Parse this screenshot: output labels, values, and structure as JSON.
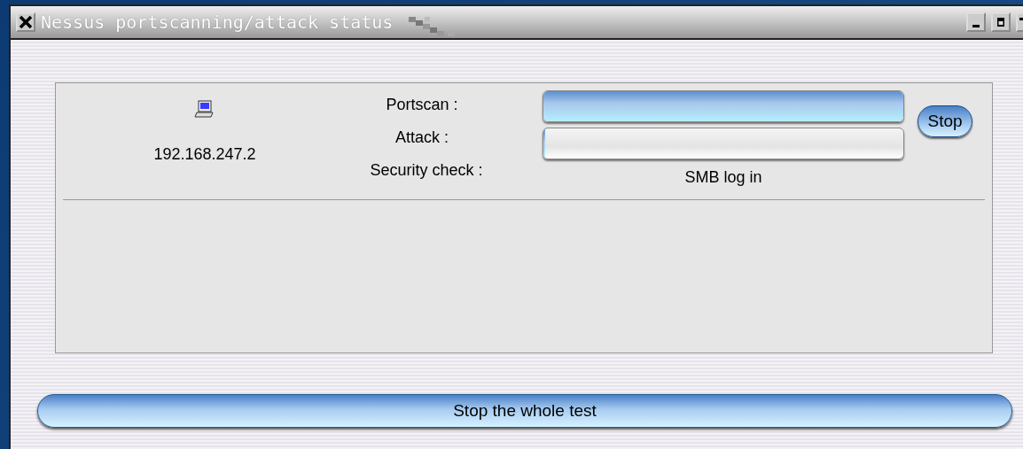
{
  "window": {
    "title": "Nessus portscanning/attack status"
  },
  "hosts": [
    {
      "address": "192.168.247.2",
      "labels": [
        "Portscan :",
        "Attack :",
        "Security check :"
      ],
      "portscan": {
        "level": 1
      },
      "attack": {
        "level": 0.005
      },
      "security_check": "SMB log in",
      "button": "Stop"
    }
  ],
  "stop_all_button": "Stop the whole test"
}
